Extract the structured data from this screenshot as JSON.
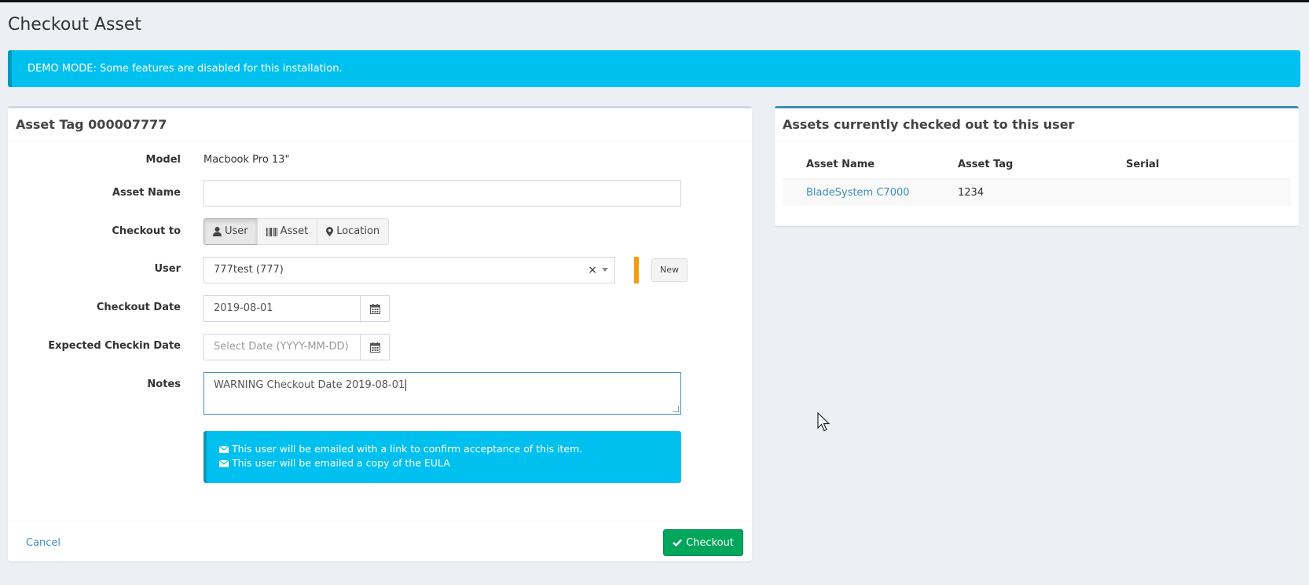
{
  "page": {
    "title": "Checkout Asset"
  },
  "alert": {
    "demo_text": "DEMO MODE: Some features are disabled for this installation."
  },
  "form": {
    "header": "Asset Tag 000007777",
    "model_label": "Model",
    "model_value": "Macbook Pro 13\"",
    "asset_name_label": "Asset Name",
    "asset_name_value": "",
    "checkout_to_label": "Checkout to",
    "checkout_to_options": [
      {
        "label": "User",
        "icon": "user-icon",
        "active": true
      },
      {
        "label": "Asset",
        "icon": "barcode-icon",
        "active": false
      },
      {
        "label": "Location",
        "icon": "map-marker-icon",
        "active": false
      }
    ],
    "user_label": "User",
    "user_value": "777test (777)",
    "user_clear": "×",
    "new_button": "New",
    "checkout_date_label": "Checkout Date",
    "checkout_date_value": "2019-08-01",
    "expected_checkin_label": "Expected Checkin Date",
    "expected_checkin_placeholder": "Select Date (YYYY-MM-DD)",
    "notes_label": "Notes",
    "notes_value": "WARNING Checkout Date 2019-08-01",
    "email_notice_1": "This user will be emailed with a link to confirm acceptance of this item.",
    "email_notice_2": "This user will be emailed a copy of the EULA",
    "cancel": "Cancel",
    "checkout_button": "Checkout"
  },
  "assigned": {
    "header": "Assets currently checked out to this user",
    "columns": [
      "Asset Name",
      "Asset Tag",
      "Serial"
    ],
    "rows": [
      {
        "name": "BladeSystem C7000",
        "tag": "1234",
        "serial": ""
      }
    ]
  },
  "colors": {
    "info": "#00c0ef",
    "success": "#00a65a",
    "primary": "#3c8dbc",
    "warning": "#f39c12"
  }
}
